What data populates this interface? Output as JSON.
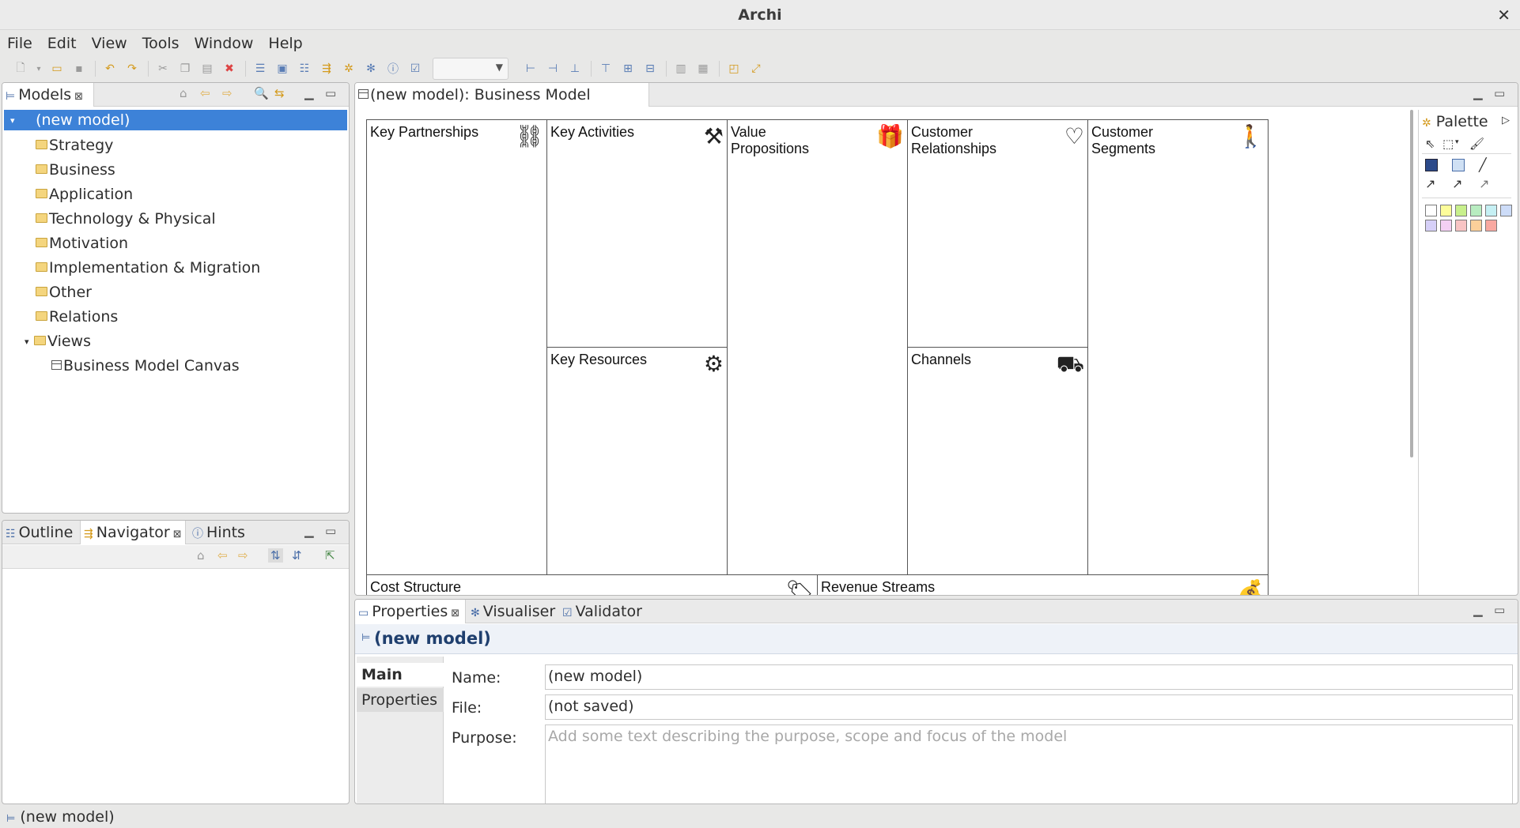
{
  "window": {
    "title": "Archi",
    "close_glyph": "✕"
  },
  "menu": [
    "File",
    "Edit",
    "View",
    "Tools",
    "Window",
    "Help"
  ],
  "models_panel": {
    "tab_label": "Models",
    "tree": [
      {
        "label": "(new model)",
        "selected": true
      },
      {
        "label": "Strategy"
      },
      {
        "label": "Business"
      },
      {
        "label": "Application"
      },
      {
        "label": "Technology & Physical"
      },
      {
        "label": "Motivation"
      },
      {
        "label": "Implementation & Migration"
      },
      {
        "label": "Other"
      },
      {
        "label": "Relations"
      },
      {
        "label": "Views"
      },
      {
        "label": "Business Model Canvas"
      }
    ]
  },
  "outline_panel": {
    "tabs": [
      "Outline",
      "Navigator",
      "Hints"
    ]
  },
  "editor": {
    "tab_label": "(new model): Business Model Canvas",
    "blocks": {
      "key_partnerships": "Key Partnerships",
      "key_activities": "Key Activities",
      "value_propositions": "Value\nPropositions",
      "customer_relationships": "Customer\nRelationships",
      "customer_segments": "Customer\nSegments",
      "key_resources": "Key Resources",
      "channels": "Channels",
      "cost_structure": "Cost Structure",
      "revenue_streams": "Revenue Streams"
    },
    "palette_title": "Palette",
    "palette_colors": [
      "#ffffff",
      "#fdfd9a",
      "#c8f08c",
      "#b8ecc0",
      "#c6f0f4",
      "#cddcf8",
      "#d6d0f8",
      "#f4d0f4",
      "#f8c4c4",
      "#fbd09a",
      "#f8a8a0"
    ]
  },
  "properties_panel": {
    "tabs": [
      "Properties",
      "Visualiser",
      "Validator"
    ],
    "header": "(new model)",
    "side_tabs": [
      "Main",
      "Properties"
    ],
    "fields": {
      "name_label": "Name:",
      "name_value": "(new model)",
      "file_label": "File:",
      "file_value": "(not saved)",
      "purpose_label": "Purpose:",
      "purpose_placeholder": "Add some text describing the purpose, scope and focus of the model"
    }
  },
  "status_bar": {
    "text": "(new model)"
  }
}
